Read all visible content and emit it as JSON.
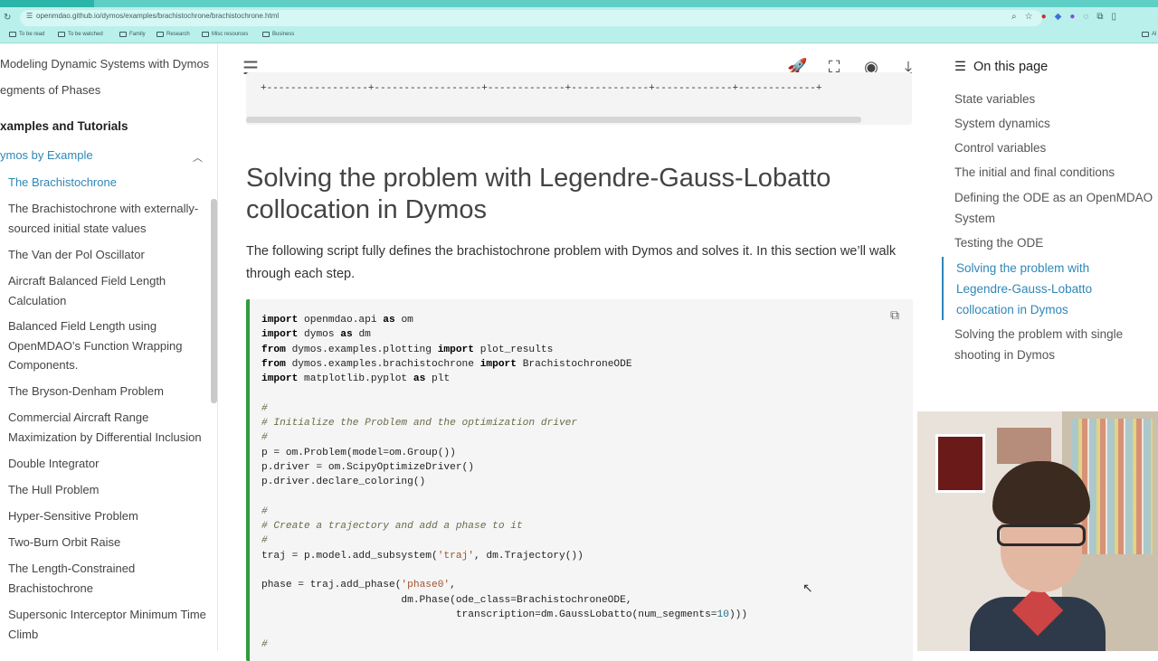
{
  "browser": {
    "url": "openmdao.github.io/dymos/examples/brachistochrone/brachistochrone.html",
    "bookmarks": [
      "To be read",
      "To be watched",
      "Family",
      "Research",
      "Misc resources",
      "Business"
    ],
    "right_label": "Al"
  },
  "sidebar": {
    "top_items": [
      "Modeling Dynamic Systems with Dymos",
      "egments of Phases"
    ],
    "section_label": "xamples and Tutorials",
    "group_label": "ymos by Example",
    "items": [
      "The Brachistochrone",
      "The Brachistochrone with externally-sourced initial state values",
      "The Van der Pol Oscillator",
      "Aircraft Balanced Field Length Calculation",
      "Balanced Field Length using OpenMDAO’s Function Wrapping Components.",
      "The Bryson-Denham Problem",
      "Commercial Aircraft Range Maximization by Differential Inclusion",
      "Double Integrator",
      "The Hull Problem",
      "Hyper-Sensitive Problem",
      "Two-Burn Orbit Raise",
      "The Length-Constrained Brachistochrone",
      "Supersonic Interceptor Minimum Time Climb"
    ]
  },
  "header": {
    "icons": [
      "rocket-icon",
      "fullscreen-icon",
      "github-icon",
      "download-icon"
    ]
  },
  "main": {
    "table_border": "+-----------------+------------------+-------------+-------------+-------------+-------------+",
    "title": "Solving the problem with Legendre-Gauss-Lobatto collocation in Dymos",
    "paragraph": "The following script fully defines the brachistochrone problem with Dymos and solves it. In this section we’ll walk through each step."
  },
  "toc": {
    "heading": "On this page",
    "items": [
      "State variables",
      "System dynamics",
      "Control variables",
      "The initial and final conditions",
      "Defining the ODE as an OpenMDAO System",
      "Testing the ODE",
      "Solving the problem with Legendre-Gauss-Lobatto collocation in Dymos",
      "Solving the problem with single shooting in Dymos"
    ]
  },
  "colors": {
    "accent": "#2e87b8",
    "code_border": "#2e9c3e",
    "browser_bar": "#b9f0ec"
  }
}
